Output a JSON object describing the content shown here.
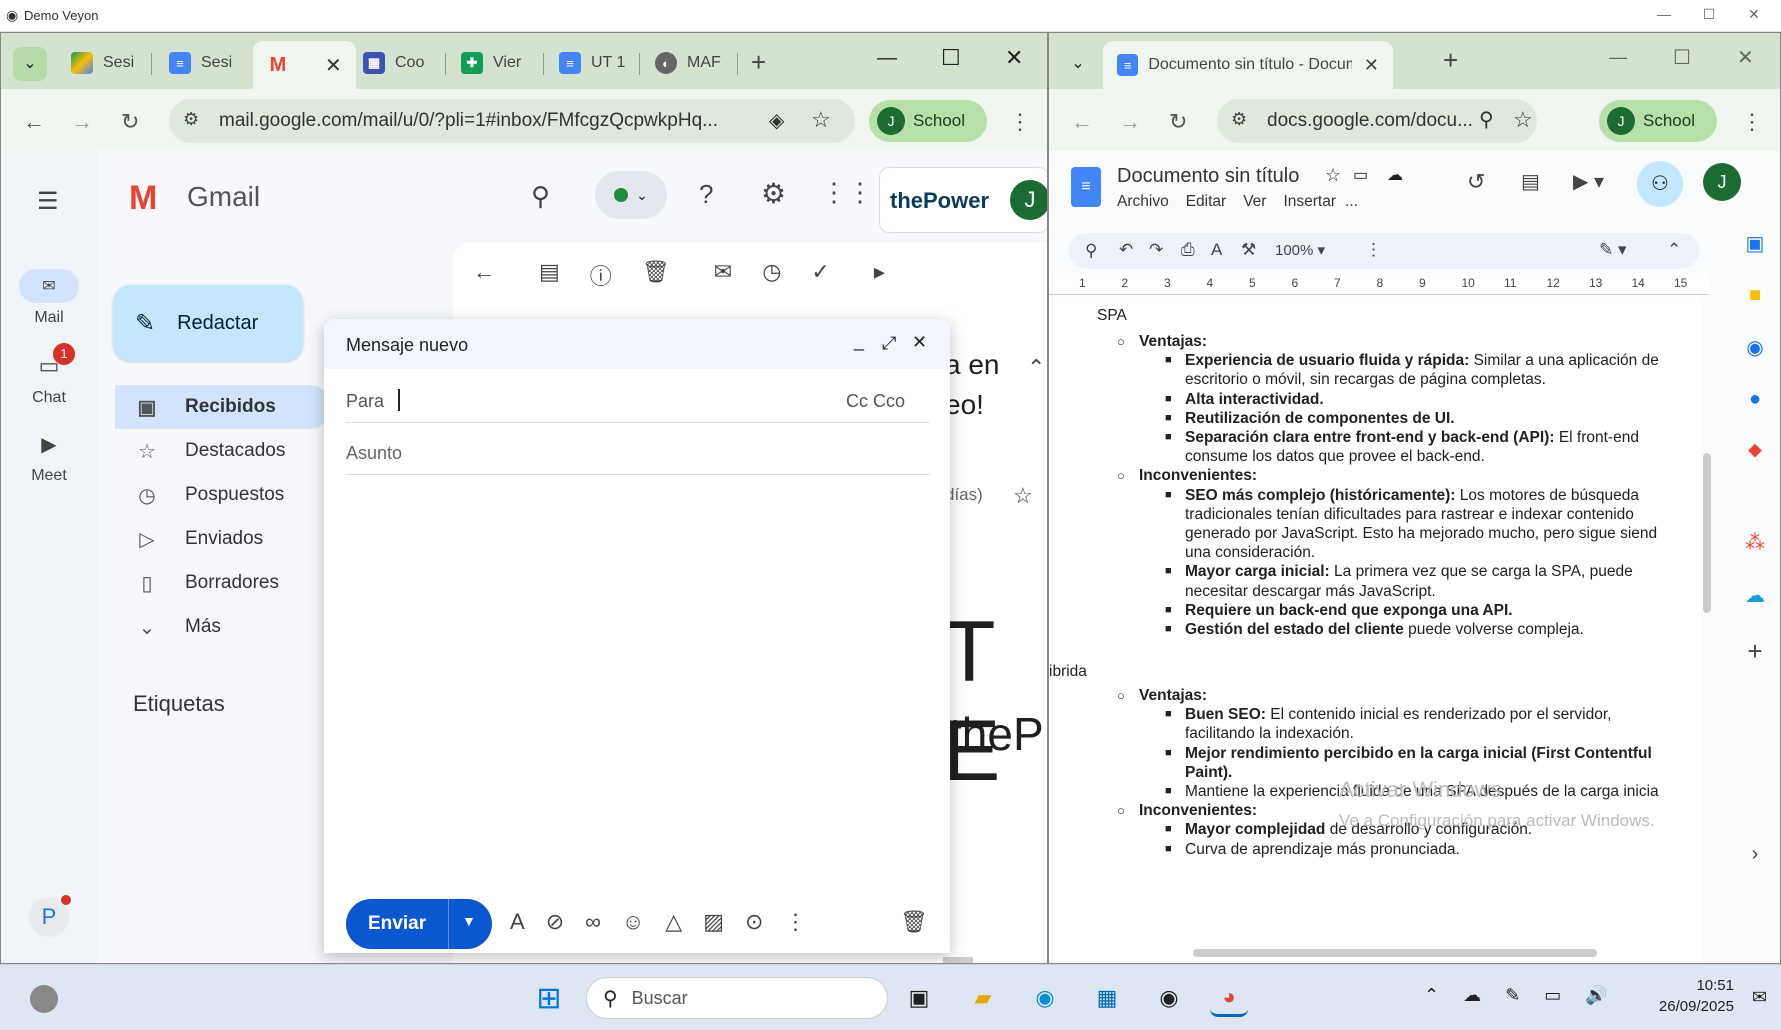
{
  "window_title": "Demo Veyon",
  "gmail_browser": {
    "tabs": [
      {
        "label": "Sesi",
        "icon": "drive-icon"
      },
      {
        "label": "Sesi",
        "icon": "docs-icon"
      },
      {
        "label": "",
        "icon": "gmail-icon"
      },
      {
        "label": "Coo",
        "icon": "forms-icon"
      },
      {
        "label": "Vier",
        "icon": "sheets-icon"
      },
      {
        "label": "UT 1",
        "icon": "docs-icon"
      },
      {
        "label": "MAF",
        "icon": "globe-icon"
      }
    ],
    "url": "mail.google.com/mail/u/0/?pli=1#inbox/FMfcgzQcpwkpHq...",
    "profile_initial": "J",
    "profile_label": "School"
  },
  "gmail": {
    "logo_text": "Gmail",
    "brand": "thePower",
    "avatar_initial": "J",
    "compose_label": "Redactar",
    "rail": [
      {
        "label": "Mail",
        "icon": "mail-icon"
      },
      {
        "label": "Chat",
        "icon": "chat-icon",
        "badge": "1"
      },
      {
        "label": "Meet",
        "icon": "meet-icon"
      }
    ],
    "rail_avatar": "P",
    "nav": [
      {
        "label": "Recibidos",
        "icon": "inbox-icon"
      },
      {
        "label": "Destacados",
        "icon": "star-icon"
      },
      {
        "label": "Pospuestos",
        "icon": "clock-icon"
      },
      {
        "label": "Enviados",
        "icon": "send-icon"
      },
      {
        "label": "Borradores",
        "icon": "draft-icon"
      },
      {
        "label": "Más",
        "icon": "chevron-down-icon"
      }
    ],
    "labels_title": "Etiquetas",
    "bg_text": {
      "line1": "a en",
      "line2": "eo!",
      "days": "días)",
      "big1": "T E",
      "big2": "theP"
    }
  },
  "compose": {
    "title": "Mensaje nuevo",
    "to_label": "Para",
    "cc_label": "Cc Cco",
    "subject_placeholder": "Asunto",
    "send_label": "Enviar"
  },
  "docs_browser": {
    "tab_title": "Documento sin título - Docume",
    "url": "docs.google.com/docu...",
    "profile_initial": "J",
    "profile_label": "School"
  },
  "doc": {
    "title": "Documento sin título",
    "menu": [
      "Archivo",
      "Editar",
      "Ver",
      "Insertar",
      "..."
    ],
    "zoom": "100%",
    "ruler": [
      "1",
      "2",
      "3",
      "4",
      "5",
      "6",
      "7",
      "8",
      "9",
      "10",
      "11",
      "12",
      "13",
      "14",
      "15"
    ],
    "heading_spa": "SPA",
    "hibrida": "ibrida",
    "lines": [
      {
        "lvl": 1,
        "bold": "Ventajas:",
        "text": ""
      },
      {
        "lvl": 2,
        "bold": "Experiencia de usuario fluida y rápida:",
        "text": " Similar a una aplicación de"
      },
      {
        "lvl": 3,
        "bold": "",
        "text": "escritorio o móvil, sin recargas de página completas."
      },
      {
        "lvl": 2,
        "bold": "Alta interactividad.",
        "text": ""
      },
      {
        "lvl": 2,
        "bold": "Reutilización de componentes de UI.",
        "text": ""
      },
      {
        "lvl": 2,
        "bold": "Separación clara entre front-end y back-end (API):",
        "text": " El front-end"
      },
      {
        "lvl": 3,
        "bold": "",
        "text": "consume los datos que provee el back-end."
      },
      {
        "lvl": 1,
        "bold": "Inconvenientes:",
        "text": ""
      },
      {
        "lvl": 2,
        "bold": "SEO más complejo (históricamente):",
        "text": " Los motores de búsqueda"
      },
      {
        "lvl": 3,
        "bold": "",
        "text": "tradicionales tenían dificultades para rastrear e indexar contenido"
      },
      {
        "lvl": 3,
        "bold": "",
        "text": "generado por JavaScript. Esto ha mejorado mucho, pero sigue siend"
      },
      {
        "lvl": 3,
        "bold": "",
        "text": "una consideración."
      },
      {
        "lvl": 2,
        "bold": "Mayor carga inicial:",
        "text": " La primera vez que se carga la SPA, puede"
      },
      {
        "lvl": 3,
        "bold": "",
        "text": "necesitar descargar más JavaScript."
      },
      {
        "lvl": 2,
        "bold": "Requiere un back-end que exponga una API.",
        "text": ""
      },
      {
        "lvl": 2,
        "bold": "Gestión del estado del cliente",
        "text": " puede volverse compleja."
      }
    ],
    "lines2": [
      {
        "lvl": 1,
        "bold": "Ventajas:",
        "text": ""
      },
      {
        "lvl": 2,
        "bold": "Buen SEO:",
        "text": " El contenido inicial es renderizado por el servidor,"
      },
      {
        "lvl": 3,
        "bold": "",
        "text": "facilitando la indexación."
      },
      {
        "lvl": 2,
        "bold": "Mejor rendimiento percibido en la carga inicial (First Contentful",
        "text": ""
      },
      {
        "lvl": 3,
        "bold": "Paint).",
        "text": ""
      },
      {
        "lvl": 2,
        "bold": "",
        "text": "Mantiene la experiencia fluida de una SPA después de la carga inicia"
      },
      {
        "lvl": 1,
        "bold": "Inconvenientes:",
        "text": ""
      },
      {
        "lvl": 2,
        "bold": "Mayor complejidad",
        "text": " de desarrollo y configuración."
      },
      {
        "lvl": 2,
        "bold": "",
        "text": "Curva de aprendizaje más pronunciada."
      }
    ],
    "watermark1": "Activar Windows",
    "watermark2": "Ve a Configuración para activar Windows."
  },
  "taskbar": {
    "search_placeholder": "Buscar",
    "time": "10:51",
    "date": "26/09/2025"
  },
  "colors": {
    "tabbar": "#d3e3d0",
    "gmail_red": "#ea4335",
    "compose_btn": "#c2e7ff",
    "send": "#0b57d0"
  }
}
